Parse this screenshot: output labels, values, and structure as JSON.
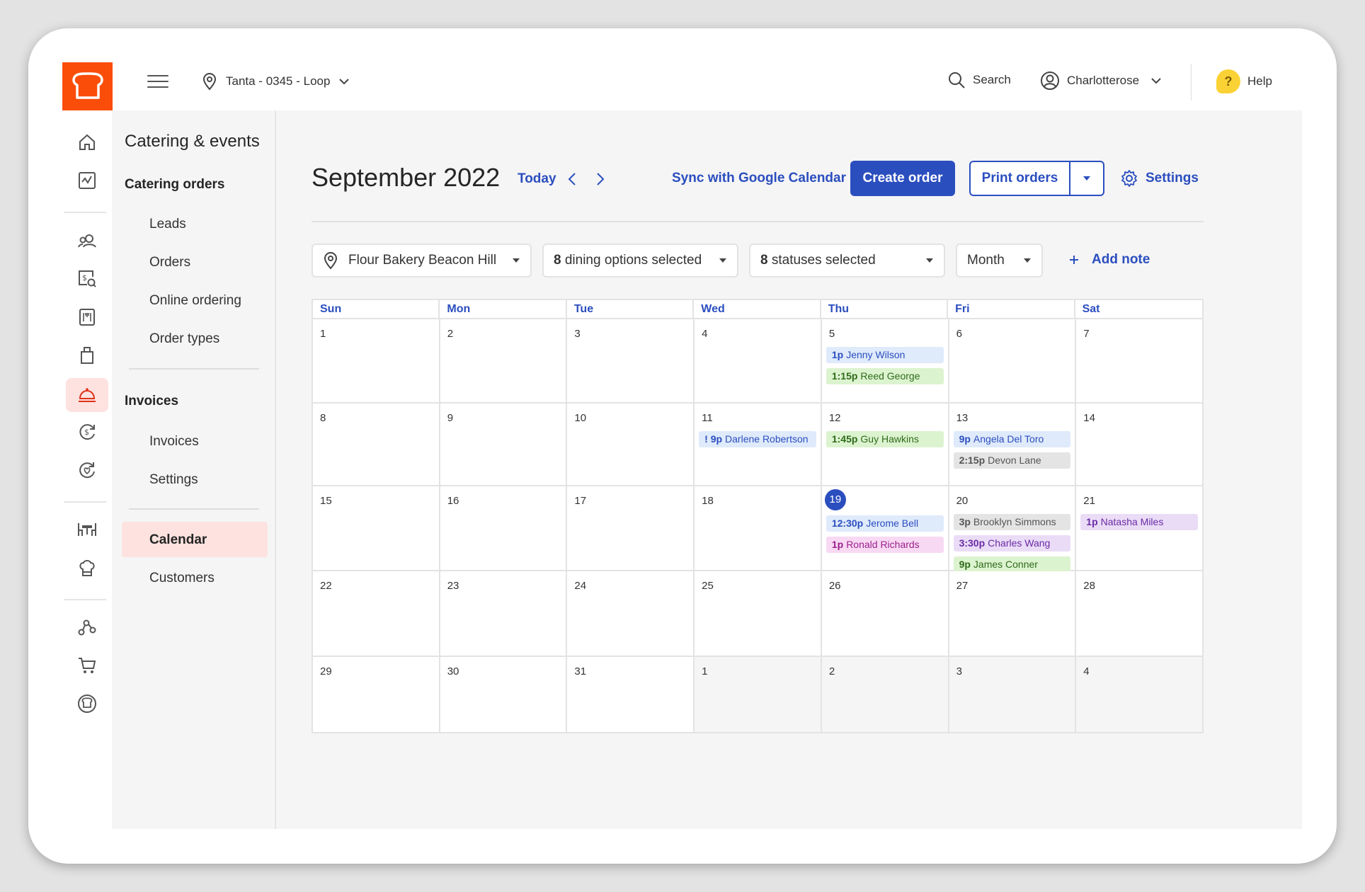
{
  "topbar": {
    "location": "Tanta - 0345 -  Loop",
    "search_label": "Search",
    "user_name": "Charlotterose",
    "help_label": "Help",
    "help_badge": "?"
  },
  "rail": {
    "icons": [
      "home-icon",
      "analytics-icon",
      "guests-icon",
      "payments-search-icon",
      "menu-icon",
      "bag-icon",
      "catering-bell-icon",
      "finance-icon",
      "marketing-icon",
      "dining-table-icon",
      "kitchen-icon",
      "integrations-icon",
      "cart-icon",
      "toast-icon"
    ],
    "active": "catering-bell-icon"
  },
  "subnav": {
    "title": "Catering & events",
    "section1": "Catering orders",
    "items1": [
      "Leads",
      "Orders",
      "Online ordering",
      "Order types"
    ],
    "section2": "Invoices",
    "items2": [
      "Invoices",
      "Settings"
    ],
    "items3": [
      "Calendar",
      "Customers"
    ],
    "active": "Calendar"
  },
  "header": {
    "month": "September 2022",
    "today": "Today",
    "sync": "Sync with Google Calendar",
    "create": "Create order",
    "print": "Print orders",
    "settings": "Settings"
  },
  "filters": {
    "location": "Flour Bakery Beacon Hill",
    "dining_count": "8",
    "dining_text": " dining options selected",
    "status_count": "8",
    "status_text": " statuses selected",
    "view": "Month",
    "add_note": "Add note"
  },
  "calendar": {
    "weekdays": [
      "Sun",
      "Mon",
      "Tue",
      "Wed",
      "Thu",
      "Fri",
      "Sat"
    ],
    "today": "19",
    "weeks": [
      [
        {
          "d": "1"
        },
        {
          "d": "2"
        },
        {
          "d": "3"
        },
        {
          "d": "4"
        },
        {
          "d": "5",
          "events": [
            {
              "time": "1p",
              "name": "Jenny Wilson",
              "color": "blue"
            },
            {
              "time": "1:15p",
              "name": "Reed George",
              "color": "green"
            }
          ]
        },
        {
          "d": "6"
        },
        {
          "d": "7"
        }
      ],
      [
        {
          "d": "8"
        },
        {
          "d": "9"
        },
        {
          "d": "10"
        },
        {
          "d": "11",
          "events": [
            {
              "time": "! 9p",
              "name": "Darlene Robertson",
              "color": "blue"
            }
          ]
        },
        {
          "d": "12",
          "events": [
            {
              "time": "1:45p",
              "name": "Guy Hawkins",
              "color": "green"
            }
          ]
        },
        {
          "d": "13",
          "events": [
            {
              "time": "9p",
              "name": "Angela Del Toro",
              "color": "blue"
            },
            {
              "time": "2:15p",
              "name": "Devon Lane",
              "color": "gray"
            }
          ]
        },
        {
          "d": "14"
        }
      ],
      [
        {
          "d": "15"
        },
        {
          "d": "16"
        },
        {
          "d": "17"
        },
        {
          "d": "18"
        },
        {
          "d": "19",
          "events": [
            {
              "time": "12:30p",
              "name": "Jerome Bell",
              "color": "blue"
            },
            {
              "time": "1p",
              "name": "Ronald Richards",
              "color": "pink"
            }
          ]
        },
        {
          "d": "20",
          "events": [
            {
              "time": "3p",
              "name": "Brooklyn Simmons",
              "color": "gray"
            },
            {
              "time": "3:30p",
              "name": "Charles Wang",
              "color": "purple"
            },
            {
              "time": "9p",
              "name": "James Conner",
              "color": "green"
            }
          ]
        },
        {
          "d": "21",
          "events": [
            {
              "time": "1p",
              "name": "Natasha Miles",
              "color": "purple"
            }
          ]
        }
      ],
      [
        {
          "d": "22"
        },
        {
          "d": "23"
        },
        {
          "d": "24"
        },
        {
          "d": "25"
        },
        {
          "d": "26"
        },
        {
          "d": "27"
        },
        {
          "d": "28"
        }
      ],
      [
        {
          "d": "29"
        },
        {
          "d": "30"
        },
        {
          "d": "31"
        },
        {
          "d": "1",
          "other": true
        },
        {
          "d": "2",
          "other": true
        },
        {
          "d": "3",
          "other": true
        },
        {
          "d": "4",
          "other": true
        }
      ]
    ]
  },
  "colors": {
    "brand": "#fa4d0a",
    "accent": "#2b4ebf",
    "active_bg": "#fde2df"
  }
}
